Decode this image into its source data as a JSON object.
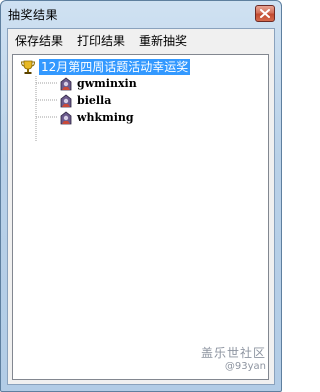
{
  "window": {
    "title": "抽奖结果",
    "close_icon": "close-icon"
  },
  "menu": {
    "items": [
      {
        "label": "保存结果"
      },
      {
        "label": "打印结果"
      },
      {
        "label": "重新抽奖"
      }
    ]
  },
  "tree": {
    "root": {
      "icon": "trophy-icon",
      "label": "12月第四周话题活动幸运奖",
      "selected": true
    },
    "children": [
      {
        "icon": "user-icon",
        "label": "gwminxin"
      },
      {
        "icon": "user-icon",
        "label": "biella"
      },
      {
        "icon": "user-icon",
        "label": "whkming"
      }
    ]
  },
  "watermark": {
    "line1": "盖乐世社区",
    "line2": "@93yan"
  },
  "colors": {
    "selection": "#3399ff",
    "titlebar": "#b9d1e8",
    "close_button": "#c24a31"
  }
}
